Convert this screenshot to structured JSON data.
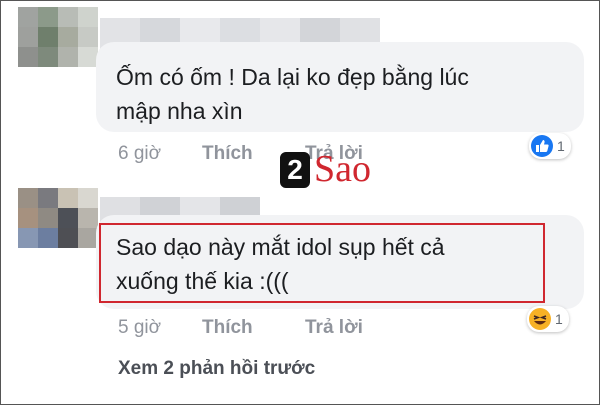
{
  "comments": [
    {
      "text_line1": "Ốm có ốm ! Da lại ko đẹp bằng lúc",
      "text_line2": "mập nha xìn",
      "time": "6 giờ",
      "like_label": "Thích",
      "reply_label": "Trả lời",
      "reaction_count": "1",
      "reaction_icon": "like-icon"
    },
    {
      "text_line1": "Sao dạo này mắt idol sụp hết cả",
      "text_line2": "xuống thế kia :(((",
      "time": "5 giờ",
      "like_label": "Thích",
      "reply_label": "Trả lời",
      "reaction_count": "1",
      "reaction_icon": "haha-icon"
    }
  ],
  "watermark": {
    "number": "2",
    "word": "Sao"
  },
  "more_replies": "Xem 2 phản hồi trước",
  "colors": {
    "bubble": "#f2f3f5",
    "highlight": "#d0272f",
    "action_text": "#90949c",
    "like_blue": "#1877f2",
    "haha_yellow": "#f7b125"
  }
}
